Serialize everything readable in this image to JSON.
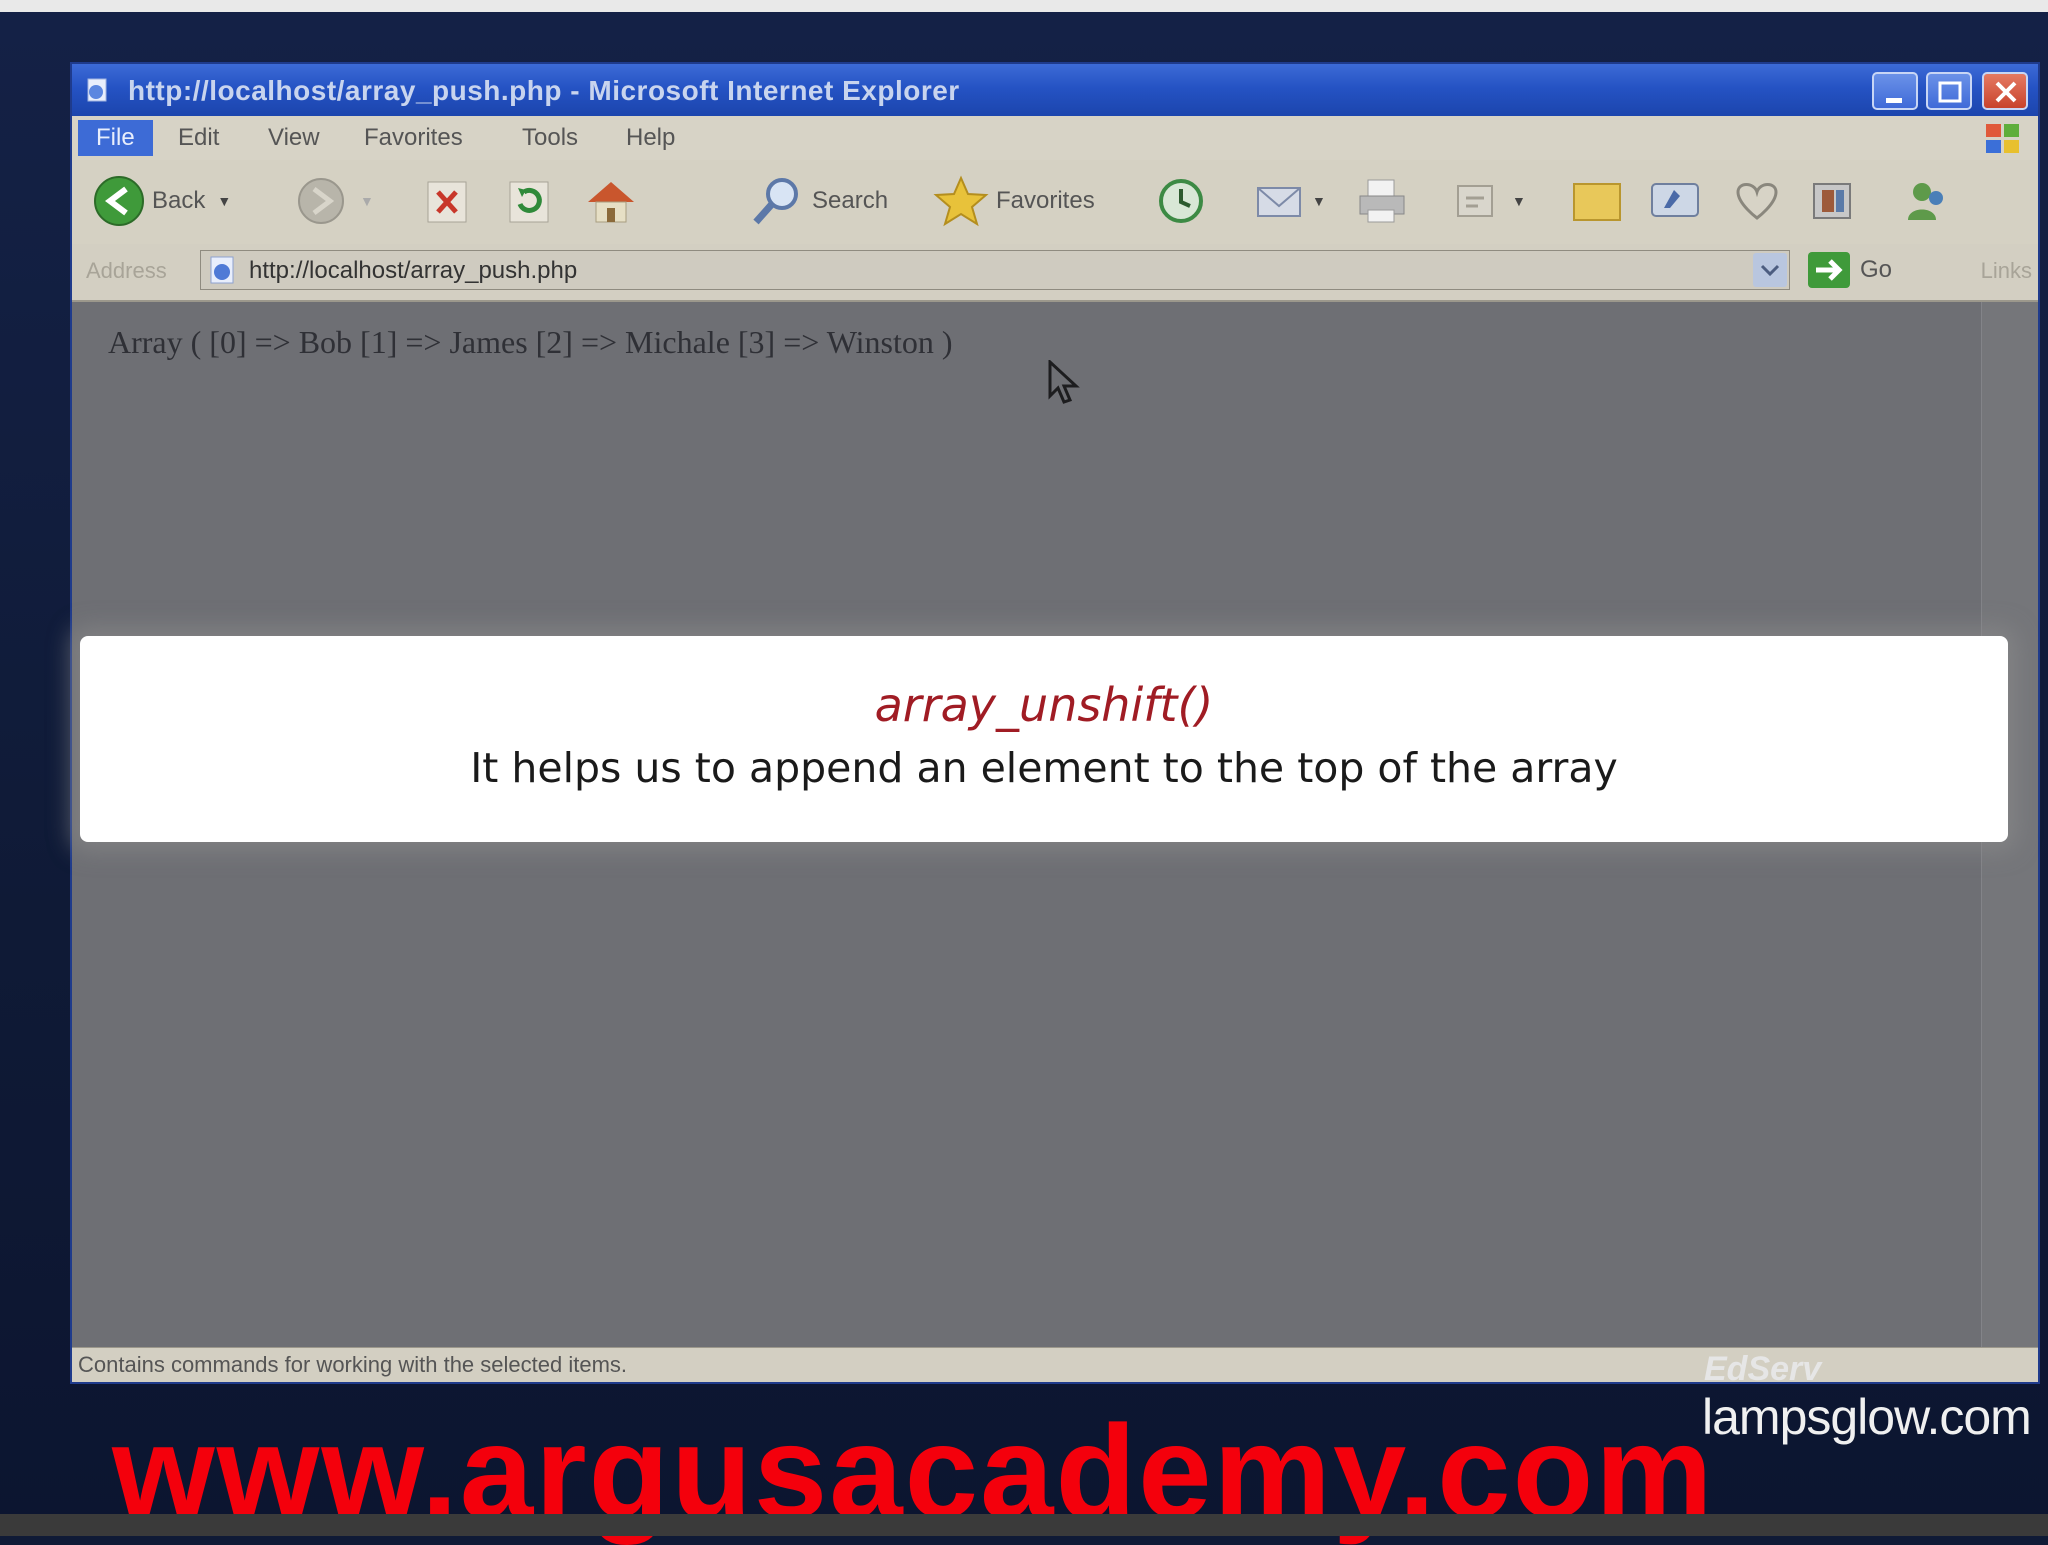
{
  "window": {
    "title": "http://localhost/array_push.php - Microsoft Internet Explorer"
  },
  "menu": {
    "file": "File",
    "edit": "Edit",
    "view": "View",
    "favorites": "Favorites",
    "tools": "Tools",
    "help": "Help"
  },
  "toolbar": {
    "back": "Back",
    "search": "Search",
    "favorites": "Favorites"
  },
  "address": {
    "label": "Address",
    "url": "http://localhost/array_push.php",
    "go": "Go",
    "links": "Links"
  },
  "page": {
    "output": "Array ( [0] => Bob [1] => James [2] => Michale [3] => Winston )"
  },
  "status": {
    "text": "Contains commands for working with the selected items."
  },
  "caption": {
    "function": "array_unshift()",
    "description": "It helps us to append an element to the top of the array"
  },
  "brand": {
    "small": "EdServ",
    "domain": "lampsglow.com",
    "watermark": "www.argusacademy.com"
  }
}
